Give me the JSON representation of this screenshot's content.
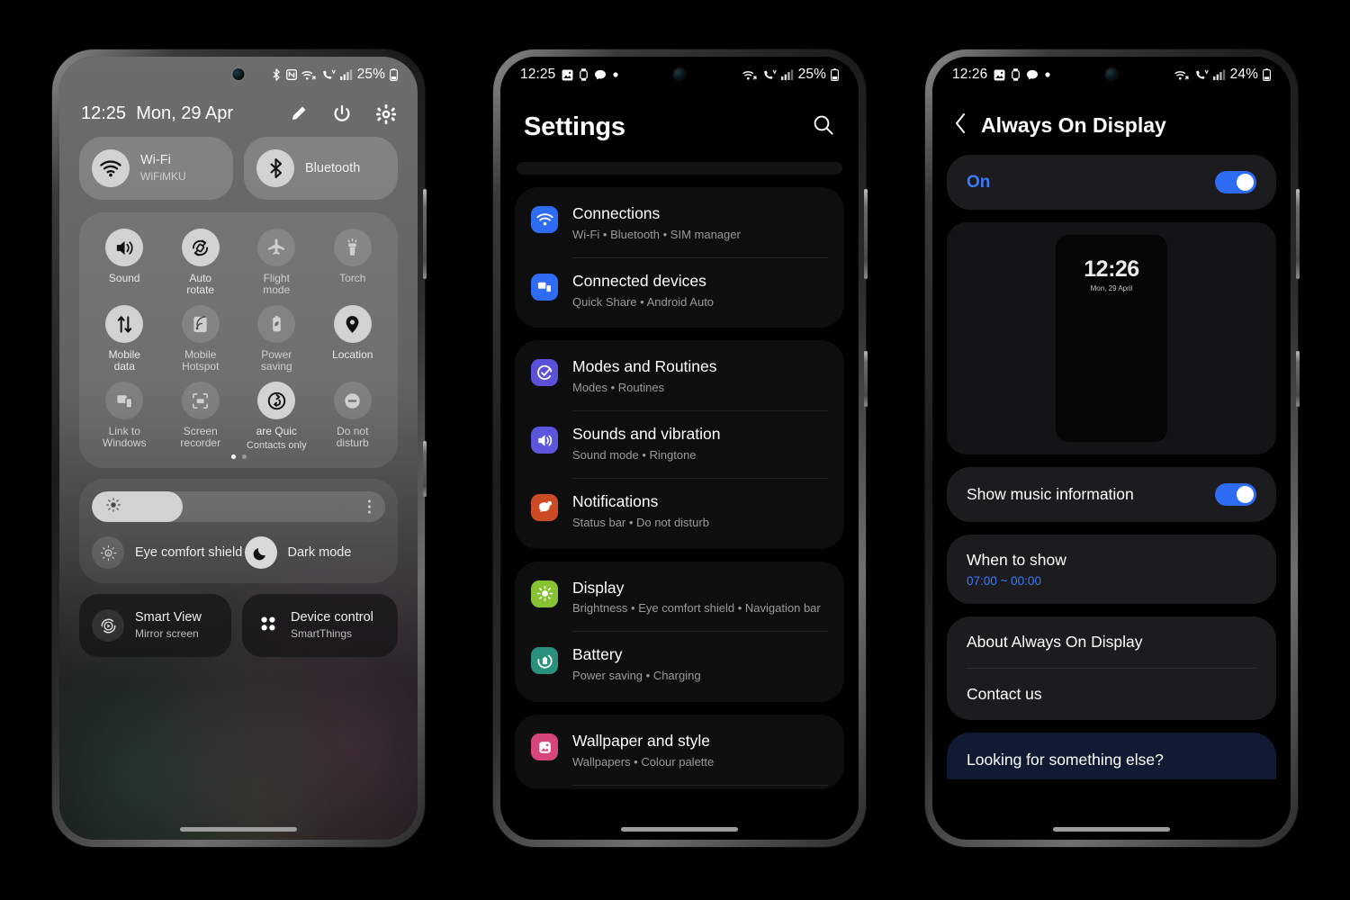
{
  "phone1": {
    "statusbar": {
      "icons": [
        "bluetooth-icon",
        "nfc-icon",
        "wifi-transfer-icon",
        "volte-call-icon",
        "signal-bars-icon"
      ],
      "battery_percent": "25%"
    },
    "header": {
      "time": "12:25",
      "date": "Mon, 29 Apr",
      "buttons": [
        "edit-pencil-icon",
        "power-icon",
        "settings-gear-icon"
      ]
    },
    "pills": [
      {
        "name": "wifi",
        "title": "Wi-Fi",
        "subtitle": "WiFiMKU",
        "state": "on"
      },
      {
        "name": "bluetooth",
        "title": "Bluetooth",
        "subtitle": "",
        "state": "on"
      }
    ],
    "tiles": [
      {
        "name": "sound",
        "label": "Sound",
        "state": "on"
      },
      {
        "name": "auto-rotate",
        "label": "Auto\nrotate",
        "state": "on"
      },
      {
        "name": "flight-mode",
        "label": "Flight\nmode",
        "state": "off"
      },
      {
        "name": "torch",
        "label": "Torch",
        "state": "off"
      },
      {
        "name": "mobile-data",
        "label": "Mobile\ndata",
        "state": "on"
      },
      {
        "name": "mobile-hotspot",
        "label": "Mobile\nHotspot",
        "state": "off"
      },
      {
        "name": "power-saving",
        "label": "Power\nsaving",
        "state": "off"
      },
      {
        "name": "location",
        "label": "Location",
        "state": "on"
      },
      {
        "name": "link-to-windows",
        "label": "Link to\nWindows",
        "state": "off"
      },
      {
        "name": "screen-recorder",
        "label": "Screen\nrecorder",
        "state": "off"
      },
      {
        "name": "quick-share",
        "label": "are      Quic",
        "sublabel": "Contacts only",
        "state": "on"
      },
      {
        "name": "do-not-disturb",
        "label": "Do not\ndisturb",
        "state": "off"
      }
    ],
    "pages": {
      "count": 2,
      "active": 1
    },
    "brightness": {
      "value_percent": 31
    },
    "modes": [
      {
        "name": "eye-comfort-shield",
        "label": "Eye comfort shield",
        "state": "off"
      },
      {
        "name": "dark-mode",
        "label": "Dark mode",
        "state": "on"
      }
    ],
    "bottom_cards": [
      {
        "name": "smart-view",
        "title": "Smart View",
        "subtitle": "Mirror screen"
      },
      {
        "name": "device-control",
        "title": "Device control",
        "subtitle": "SmartThings"
      }
    ]
  },
  "phone2": {
    "statusbar": {
      "time": "12:25",
      "left_icons": [
        "gallery-icon",
        "watch-icon",
        "chat-bubble-icon",
        "dot-icon"
      ],
      "right_icons": [
        "wifi-transfer-icon",
        "volte-call-icon",
        "signal-bars-icon"
      ],
      "battery_percent": "25%"
    },
    "title": "Settings",
    "search_icon": "search-icon",
    "groups": [
      {
        "items": [
          {
            "name": "connections",
            "title": "Connections",
            "subtitle": "Wi-Fi  •  Bluetooth  •  SIM manager",
            "icon": "wifi-icon",
            "color": "#2f6cf6"
          },
          {
            "name": "connected-devices",
            "title": "Connected devices",
            "subtitle": "Quick Share  •  Android Auto",
            "icon": "devices-icon",
            "color": "#2f6cf6"
          }
        ]
      },
      {
        "items": [
          {
            "name": "modes-and-routines",
            "title": "Modes and Routines",
            "subtitle": "Modes  •  Routines",
            "icon": "check-circle-icon",
            "color": "#5b51d8"
          },
          {
            "name": "sounds-and-vibration",
            "title": "Sounds and vibration",
            "subtitle": "Sound mode  •  Ringtone",
            "icon": "speaker-icon",
            "color": "#5b56db"
          },
          {
            "name": "notifications",
            "title": "Notifications",
            "subtitle": "Status bar  •  Do not disturb",
            "icon": "bell-bubble-icon",
            "color": "#cc4a24"
          }
        ]
      },
      {
        "items": [
          {
            "name": "display",
            "title": "Display",
            "subtitle": "Brightness  •  Eye comfort shield  •  Navigation bar",
            "icon": "sun-icon",
            "color": "#86c232"
          },
          {
            "name": "battery",
            "title": "Battery",
            "subtitle": "Power saving  •  Charging",
            "icon": "battery-icon",
            "color": "#2a8f7d"
          }
        ]
      },
      {
        "items": [
          {
            "name": "wallpaper-and-style",
            "title": "Wallpaper and style",
            "subtitle": "Wallpapers  •  Colour palette",
            "icon": "picture-icon",
            "color": "#d6467a"
          }
        ]
      }
    ]
  },
  "phone3": {
    "statusbar": {
      "time": "12:26",
      "left_icons": [
        "gallery-icon",
        "watch-icon",
        "chat-bubble-icon",
        "dot-icon"
      ],
      "right_icons": [
        "wifi-transfer-icon",
        "volte-call-icon",
        "signal-bars-icon"
      ],
      "battery_percent": "24%"
    },
    "back_icon": "chevron-left-icon",
    "title": "Always On Display",
    "master_toggle": {
      "label": "On",
      "state": "on"
    },
    "preview": {
      "time": "12:26",
      "date": "Mon, 29 April"
    },
    "rows": [
      {
        "name": "show-music-information",
        "label": "Show music information",
        "type": "toggle",
        "state": "on"
      },
      {
        "name": "when-to-show",
        "label": "When to show",
        "value": "07:00 ~ 00:00",
        "type": "value"
      }
    ],
    "links": [
      {
        "name": "about-always-on-display",
        "label": "About Always On Display"
      },
      {
        "name": "contact-us",
        "label": "Contact us"
      }
    ],
    "banner": {
      "label": "Looking for something else?"
    },
    "accent_color": "#3a7afe"
  }
}
